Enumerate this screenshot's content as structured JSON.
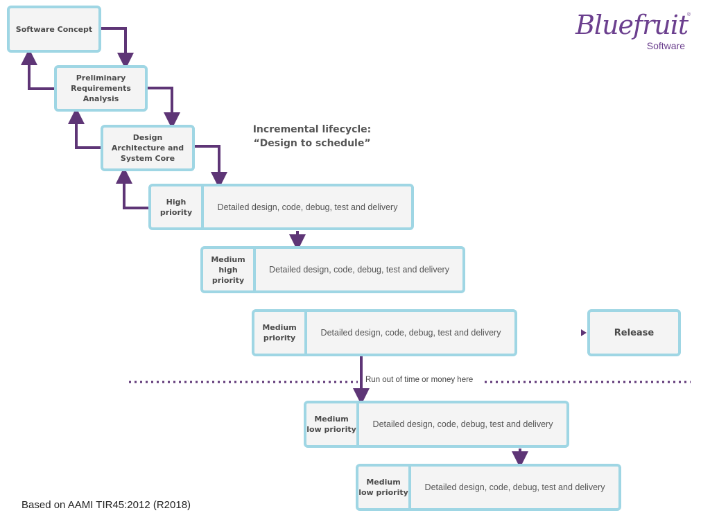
{
  "logo": {
    "script": "Bluefruit",
    "sub": "Software",
    "reg": "®",
    "color": "#6b3f8e"
  },
  "title": {
    "line1": "Incremental lifecycle:",
    "line2": "“Design to schedule”"
  },
  "stages": [
    {
      "label": "Software Concept"
    },
    {
      "label": "Preliminary Requirements Analysis"
    },
    {
      "label": "Design Architecture and System Core"
    }
  ],
  "increments": [
    {
      "priority": "High priority",
      "desc": "Detailed design, code, debug, test and delivery"
    },
    {
      "priority": "Medium high priority",
      "desc": "Detailed design, code, debug, test and delivery"
    },
    {
      "priority": "Medium priority",
      "desc": "Detailed design, code, debug, test and delivery"
    },
    {
      "priority": "Medium low priority",
      "desc": "Detailed design, code, debug, test and delivery"
    },
    {
      "priority": "Medium low priority",
      "desc": "Detailed design, code, debug, test and delivery"
    }
  ],
  "release": {
    "label": "Release"
  },
  "cutoff_note": "Run out of time or money here",
  "caption": "Based on AAMI TIR45:2012 (R2018)",
  "colors": {
    "border": "#9fd6e4",
    "arrow": "#5e3576",
    "box_fill": "#f4f4f4"
  }
}
